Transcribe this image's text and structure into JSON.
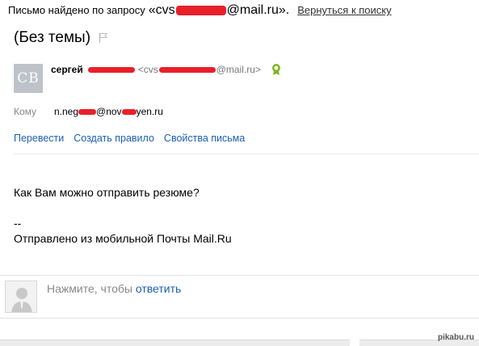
{
  "header": {
    "prefix": "Письмо найдено по запросу",
    "query_start": "«cvs",
    "query_end": "@mail.ru».",
    "back_link": "Вернуться к поиску"
  },
  "message": {
    "subject": "(Без темы)",
    "sender": {
      "avatar_initials": "CB",
      "name": "сергей",
      "email_start": "<cvs",
      "email_end": "@mail.ru>"
    },
    "to": {
      "label": "Кому",
      "value_part1": "n.neg",
      "value_part2": "@nov",
      "value_part3": "yen.ru"
    },
    "actions": [
      "Перевести",
      "Создать правило",
      "Свойства письма"
    ],
    "body": {
      "line1": "Как Вам можно отправить резюме?",
      "sig_dash": "--",
      "signature": "Отправлено из мобильной Почты Mail.Ru"
    }
  },
  "reply": {
    "prompt": "Нажмите, чтобы",
    "link": "ответить"
  },
  "watermark": "pikabu.ru",
  "colors": {
    "redaction": "#e8202a",
    "link": "#1a5fb4",
    "verified": "#7fb51f"
  }
}
